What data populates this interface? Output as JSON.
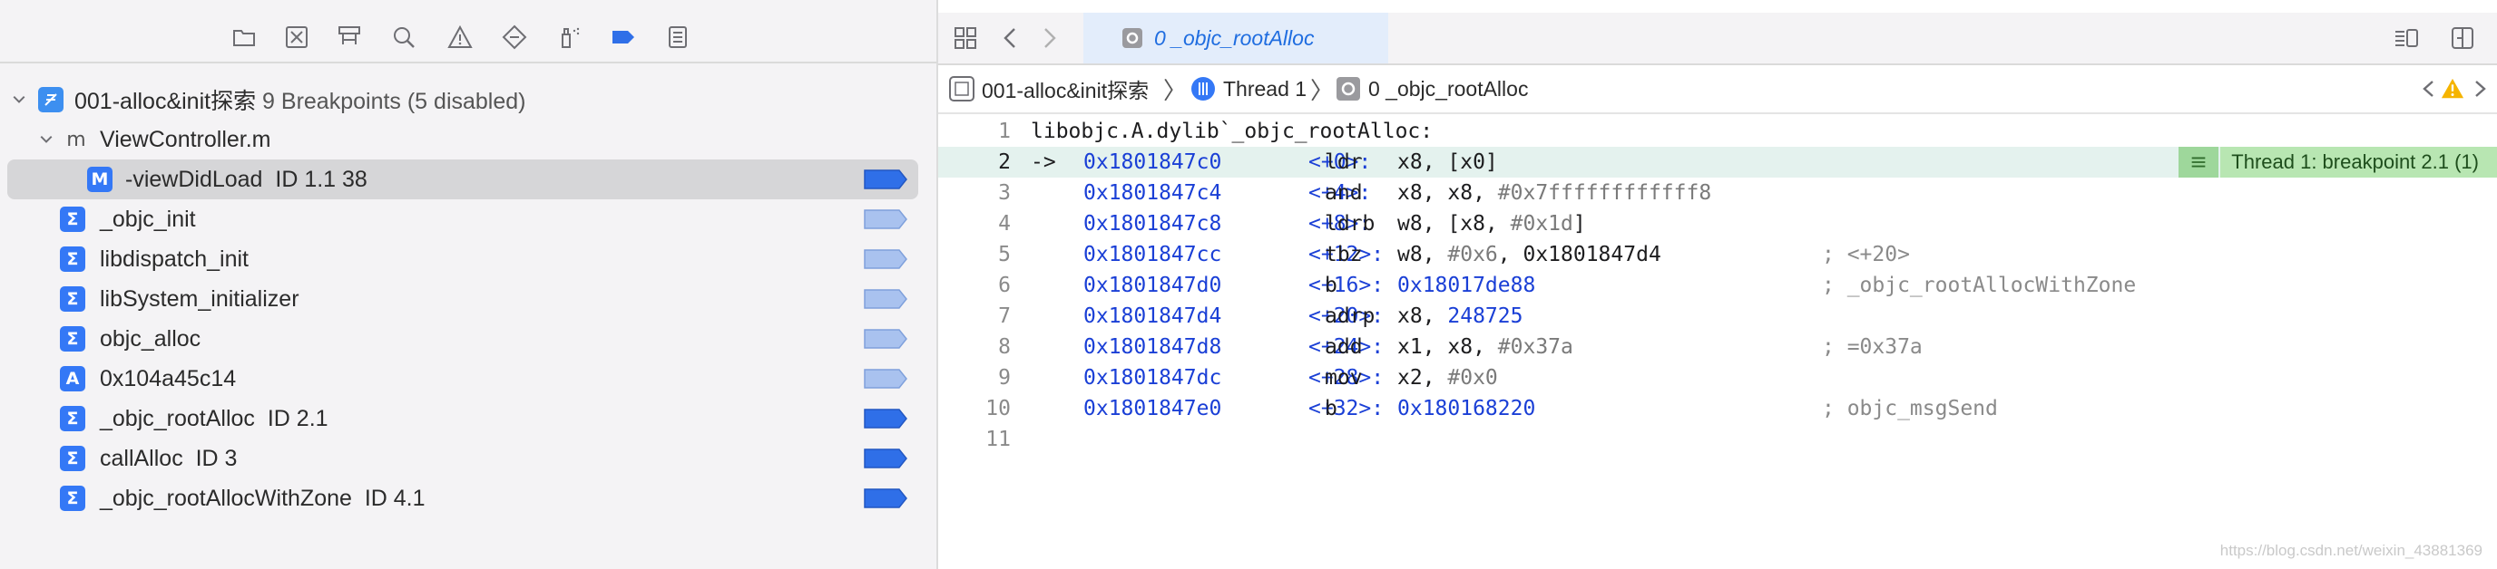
{
  "navigator": {
    "toolbar_icons": [
      "folder-icon",
      "source-control-icon",
      "hierarchy-icon",
      "search-icon",
      "issue-warning-icon",
      "test-diamond-icon",
      "debug-spray-icon",
      "breakpoint-tag-icon",
      "report-list-icon"
    ],
    "project": {
      "name": "001-alloc&init探索",
      "summary": "9 Breakpoints (5 disabled)"
    },
    "file": {
      "name": "ViewController.m"
    },
    "breakpoints": [
      {
        "icon": "M",
        "label": "-viewDidLoad",
        "detail": "ID 1.1 38",
        "enabled": true,
        "selected": true
      },
      {
        "icon": "Σ",
        "label": "_objc_init",
        "detail": "",
        "enabled": false
      },
      {
        "icon": "Σ",
        "label": "libdispatch_init",
        "detail": "",
        "enabled": false
      },
      {
        "icon": "Σ",
        "label": "libSystem_initializer",
        "detail": "",
        "enabled": false
      },
      {
        "icon": "Σ",
        "label": "objc_alloc",
        "detail": "",
        "enabled": false
      },
      {
        "icon": "A",
        "label": "0x104a45c14",
        "detail": "",
        "enabled": false
      },
      {
        "icon": "Σ",
        "label": "_objc_rootAlloc",
        "detail": "ID 2.1",
        "enabled": true
      },
      {
        "icon": "Σ",
        "label": "callAlloc",
        "detail": "ID 3",
        "enabled": true
      },
      {
        "icon": "Σ",
        "label": "_objc_rootAllocWithZone",
        "detail": "ID 4.1",
        "enabled": true
      }
    ]
  },
  "editor": {
    "tab": {
      "label": "0 _objc_rootAlloc"
    },
    "jumpbar": {
      "project": "001-alloc&init探索",
      "thread": "Thread 1",
      "frame": "0 _objc_rootAlloc"
    },
    "breakpoint_label": "Thread 1: breakpoint 2.1 (1)",
    "lines": [
      {
        "n": "1",
        "header": "libobjc.A.dylib`_objc_rootAlloc:"
      },
      {
        "n": "2",
        "arrow": "->",
        "addr": "0x1801847c0",
        "off": "<+0>:",
        "mn": "ldr",
        "ops": [
          [
            "op",
            "x8, [x0]"
          ]
        ],
        "current": true
      },
      {
        "n": "3",
        "addr": "0x1801847c4",
        "off": "<+4>:",
        "mn": "and",
        "ops": [
          [
            "op",
            "x8, x8, "
          ],
          [
            "imm",
            "#0x7ffffffffffff8"
          ]
        ]
      },
      {
        "n": "4",
        "addr": "0x1801847c8",
        "off": "<+8>:",
        "mn": "ldrb",
        "ops": [
          [
            "op",
            "w8, [x8, "
          ],
          [
            "imm",
            "#0x1d"
          ],
          [
            "op",
            "]"
          ]
        ]
      },
      {
        "n": "5",
        "addr": "0x1801847cc",
        "off": "<+12>:",
        "mn": "tbz",
        "ops": [
          [
            "op",
            "w8, "
          ],
          [
            "imm",
            "#0x6"
          ],
          [
            "op",
            ", 0x1801847d4"
          ]
        ],
        "cmt": "; <+20>"
      },
      {
        "n": "6",
        "addr": "0x1801847d0",
        "off": "<+16>:",
        "mn": "b",
        "ops": [
          [
            "num",
            "0x18017de88"
          ]
        ],
        "cmt": "; _objc_rootAllocWithZone"
      },
      {
        "n": "7",
        "addr": "0x1801847d4",
        "off": "<+20>:",
        "mn": "adrp",
        "ops": [
          [
            "op",
            "x8, "
          ],
          [
            "num",
            "248725"
          ]
        ]
      },
      {
        "n": "8",
        "addr": "0x1801847d8",
        "off": "<+24>:",
        "mn": "add",
        "ops": [
          [
            "op",
            "x1, x8, "
          ],
          [
            "imm",
            "#0x37a"
          ]
        ],
        "cmt": "; =0x37a"
      },
      {
        "n": "9",
        "addr": "0x1801847dc",
        "off": "<+28>:",
        "mn": "mov",
        "ops": [
          [
            "op",
            "x2, "
          ],
          [
            "imm",
            "#0x0"
          ]
        ]
      },
      {
        "n": "10",
        "addr": "0x1801847e0",
        "off": "<+32>:",
        "mn": "b",
        "ops": [
          [
            "num",
            "0x180168220"
          ]
        ],
        "cmt": "; objc_msgSend"
      },
      {
        "n": "11"
      }
    ]
  },
  "watermark": "https://blog.csdn.net/weixin_43881369"
}
